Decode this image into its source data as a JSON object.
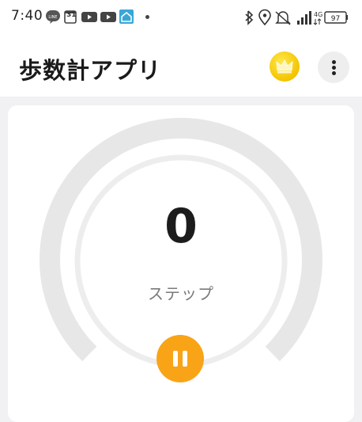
{
  "status_bar": {
    "time": "7:40",
    "calendar_date": "31",
    "network": "4G",
    "battery": "97",
    "icons": [
      "line-icon",
      "calendar-icon",
      "youtube-icon",
      "youtube-icon",
      "home-app-icon",
      "notification-dot",
      "bluetooth-icon",
      "location-icon",
      "bell-off-icon",
      "signal-icon",
      "battery-icon"
    ]
  },
  "header": {
    "title": "歩数計アプリ",
    "premium_icon": "crown-icon",
    "more_icon": "more-vertical-icon"
  },
  "pedometer": {
    "steps": "0",
    "unit_label": "ステップ",
    "progress": 0,
    "control_icon": "pause-icon"
  },
  "colors": {
    "accent": "#f9a417",
    "crown": "#f3c400",
    "ring": "#e6e6e6",
    "background": "#f1f1f4"
  }
}
